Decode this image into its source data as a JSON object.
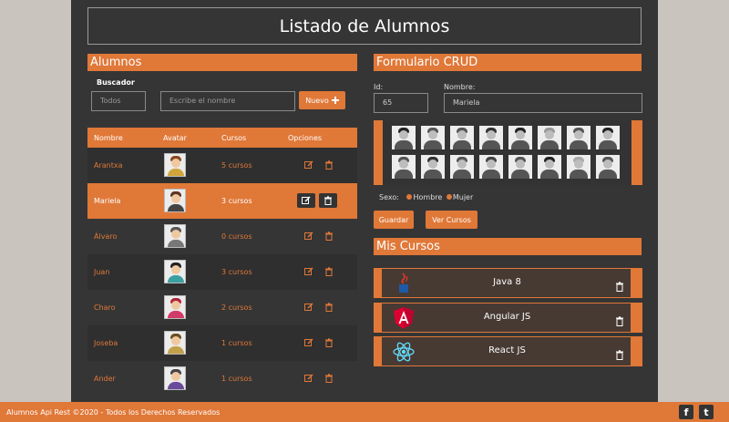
{
  "header": {
    "title": "Listado de Alumnos"
  },
  "left": {
    "section_title": "Alumnos",
    "search": {
      "label": "Buscador",
      "filter_value": "Todos",
      "name_placeholder": "Escribe el nombre",
      "new_button": "Nuevo"
    },
    "table": {
      "headers": [
        "Nombre",
        "Avatar",
        "Cursos",
        "Opciones"
      ],
      "rows": [
        {
          "name": "Arantxa",
          "courses": "5 cursos"
        },
        {
          "name": "Mariela",
          "courses": "3 cursos"
        },
        {
          "name": "Álvaro",
          "courses": "0 cursos"
        },
        {
          "name": "Juan",
          "courses": "3 cursos"
        },
        {
          "name": "Charo",
          "courses": "2 cursos"
        },
        {
          "name": "Joseba",
          "courses": "1 cursos"
        },
        {
          "name": "Ander",
          "courses": "1 cursos"
        }
      ]
    }
  },
  "form": {
    "section_title": "Formulario CRUD",
    "id_label": "Id:",
    "id_value": "65",
    "name_label": "Nombre:",
    "name_value": "Mariela",
    "sexo_label": "Sexo:",
    "hombre_label": "Hombre",
    "mujer_label": "Mujer",
    "save_button": "Guardar",
    "courses_button": "Ver Cursos"
  },
  "my_courses": {
    "section_title": "Mis Cursos",
    "items": [
      {
        "name": "Java 8",
        "icon": "java-icon"
      },
      {
        "name": "Angular JS",
        "icon": "angular-icon"
      },
      {
        "name": "React JS",
        "icon": "react-icon"
      }
    ]
  },
  "footer": {
    "text": "Alumnos Api Rest ©2020 - Todos los Derechos Reservados",
    "facebook": "f",
    "twitter": "t"
  },
  "colors": {
    "accent": "#e07838",
    "panel": "#353535",
    "page_bg": "#c9c4be",
    "course_bg": "#473a33"
  }
}
